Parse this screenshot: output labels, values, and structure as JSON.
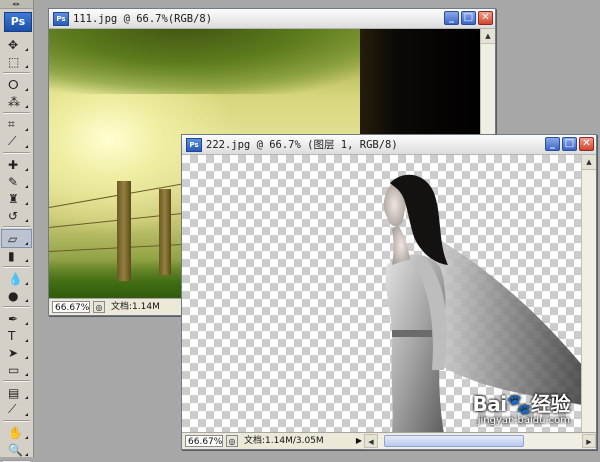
{
  "app": {
    "logo": "Ps"
  },
  "toolbox": {
    "grip": "◂▸",
    "tools": [
      {
        "name": "move-tool-icon",
        "glyph": "✥"
      },
      {
        "name": "marquee-tool-icon",
        "glyph": "⬚"
      },
      {
        "name": "lasso-tool-icon",
        "glyph": "ⵔ"
      },
      {
        "name": "magic-wand-tool-icon",
        "glyph": "⁂"
      },
      {
        "name": "crop-tool-icon",
        "glyph": "⌗"
      },
      {
        "name": "slice-tool-icon",
        "glyph": "⟋"
      },
      {
        "name": "healing-brush-tool-icon",
        "glyph": "✚"
      },
      {
        "name": "brush-tool-icon",
        "glyph": "✎"
      },
      {
        "name": "clone-stamp-tool-icon",
        "glyph": "♜"
      },
      {
        "name": "history-brush-tool-icon",
        "glyph": "↺"
      },
      {
        "name": "eraser-tool-icon",
        "glyph": "▱"
      },
      {
        "name": "gradient-tool-icon",
        "glyph": "▮"
      },
      {
        "name": "blur-tool-icon",
        "glyph": "💧"
      },
      {
        "name": "dodge-tool-icon",
        "glyph": "●"
      },
      {
        "name": "pen-tool-icon",
        "glyph": "✒"
      },
      {
        "name": "type-tool-icon",
        "glyph": "T"
      },
      {
        "name": "path-selection-tool-icon",
        "glyph": "➤"
      },
      {
        "name": "shape-tool-icon",
        "glyph": "▭"
      },
      {
        "name": "notes-tool-icon",
        "glyph": "▤"
      },
      {
        "name": "eyedropper-tool-icon",
        "glyph": "⟋"
      },
      {
        "name": "hand-tool-icon",
        "glyph": "✋"
      },
      {
        "name": "zoom-tool-icon",
        "glyph": "🔍"
      }
    ]
  },
  "window1": {
    "icon": "Ps",
    "title": "111.jpg @ 66.7%(RGB/8)",
    "buttons": {
      "minimize": "_",
      "maximize": "□",
      "close": "✕"
    },
    "status": {
      "zoom": "66.67%",
      "doc_info": "文档:1.14M"
    }
  },
  "window2": {
    "icon": "Ps",
    "title": "222.jpg @ 66.7% (图层 1, RGB/8)",
    "buttons": {
      "minimize": "_",
      "maximize": "□",
      "close": "✕"
    },
    "status": {
      "zoom": "66.67%",
      "doc_info": "文档:1.14M/3.05M"
    },
    "scroll": {
      "left": "◀",
      "right": "▶",
      "up": "▲",
      "down": "▼"
    }
  },
  "watermark": {
    "brand": "Bai🐾经验",
    "url": "jingyan.baidu.com"
  }
}
